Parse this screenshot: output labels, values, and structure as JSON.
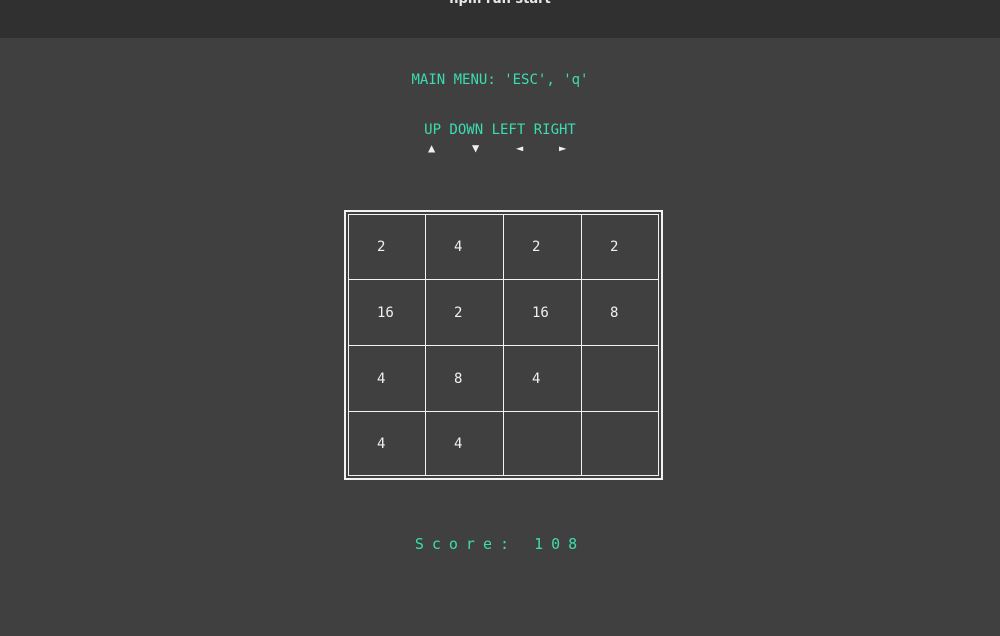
{
  "window": {
    "title": "npm run start"
  },
  "menu_hint": "MAIN MENU: 'ESC', 'q'",
  "controls": {
    "label": "UP DOWN LEFT RIGHT",
    "arrows": [
      "▲",
      "▼",
      "◄",
      "►"
    ]
  },
  "board": {
    "rows": [
      [
        "2",
        "4",
        "2",
        "2"
      ],
      [
        "16",
        "2",
        "16",
        "8"
      ],
      [
        "4",
        "8",
        "4",
        ""
      ],
      [
        "4",
        "4",
        "",
        ""
      ]
    ]
  },
  "score": {
    "label": "Score:",
    "value": "108"
  },
  "colors": {
    "background": "#404040",
    "titlebar": "#303030",
    "accent": "#3ddcb0",
    "tile_text": "#f0f0f0",
    "grid_lines": "#f2f2f2"
  }
}
